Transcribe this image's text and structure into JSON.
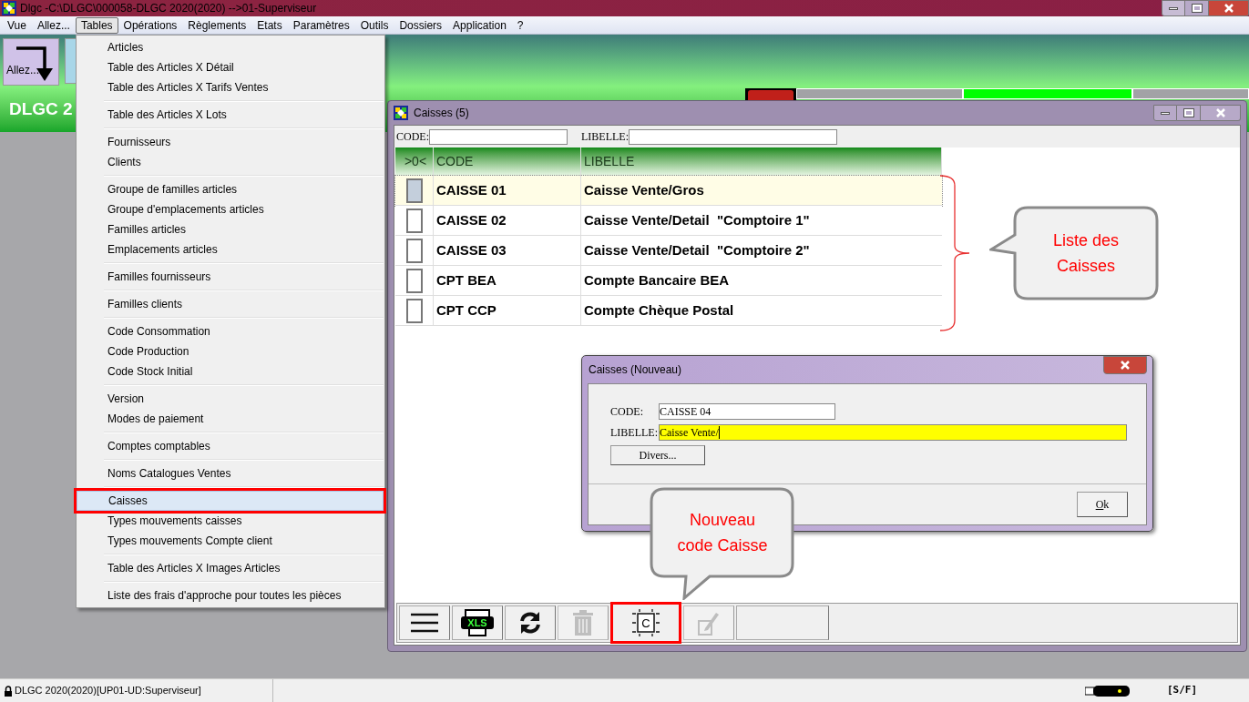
{
  "app": {
    "title": "Dlgc -C:\\DLGC\\000058-DLGC 2020(2020) -->01-Superviseur"
  },
  "menu_bar": [
    {
      "label": "Vue",
      "selected": false
    },
    {
      "label": "Allez...",
      "selected": false
    },
    {
      "label": "Tables",
      "selected": true
    },
    {
      "label": "Opérations",
      "selected": false
    },
    {
      "label": "Règlements",
      "selected": false
    },
    {
      "label": "Etats",
      "selected": false
    },
    {
      "label": "Paramètres",
      "selected": false
    },
    {
      "label": "Outils",
      "selected": false
    },
    {
      "label": "Dossiers",
      "selected": false
    },
    {
      "label": "Application",
      "selected": false
    },
    {
      "label": "?",
      "selected": false
    }
  ],
  "toolbar": {
    "go_button": "Allez...",
    "banner": "DLGC 2"
  },
  "tables_menu": {
    "groups": [
      [
        {
          "label": "Articles",
          "selected": false,
          "annotated": false
        },
        {
          "label": "Table des Articles X Détail",
          "selected": false,
          "annotated": false
        },
        {
          "label": "Table des Articles X Tarifs Ventes",
          "selected": false,
          "annotated": false
        }
      ],
      [
        {
          "label": "Table des Articles X Lots",
          "selected": false,
          "annotated": false
        }
      ],
      [
        {
          "label": "Fournisseurs",
          "selected": false,
          "annotated": false
        },
        {
          "label": "Clients",
          "selected": false,
          "annotated": false
        }
      ],
      [
        {
          "label": "Groupe de familles articles",
          "selected": false,
          "annotated": false
        },
        {
          "label": "Groupe d'emplacements articles",
          "selected": false,
          "annotated": false
        },
        {
          "label": "Familles articles",
          "selected": false,
          "annotated": false
        },
        {
          "label": "Emplacements articles",
          "selected": false,
          "annotated": false
        }
      ],
      [
        {
          "label": "Familles fournisseurs",
          "selected": false,
          "annotated": false
        }
      ],
      [
        {
          "label": "Familles clients",
          "selected": false,
          "annotated": false
        }
      ],
      [
        {
          "label": "Code Consommation",
          "selected": false,
          "annotated": false
        },
        {
          "label": "Code Production",
          "selected": false,
          "annotated": false
        },
        {
          "label": "Code Stock Initial",
          "selected": false,
          "annotated": false
        }
      ],
      [
        {
          "label": "Version",
          "selected": false,
          "annotated": false
        },
        {
          "label": "Modes de paiement",
          "selected": false,
          "annotated": false
        }
      ],
      [
        {
          "label": "Comptes comptables",
          "selected": false,
          "annotated": false
        }
      ],
      [
        {
          "label": "Noms Catalogues Ventes",
          "selected": false,
          "annotated": false
        }
      ],
      [
        {
          "label": "Caisses",
          "selected": true,
          "annotated": true
        },
        {
          "label": "Types mouvements caisses",
          "selected": false,
          "annotated": false
        },
        {
          "label": "Types mouvements Compte client",
          "selected": false,
          "annotated": false
        }
      ],
      [
        {
          "label": "Table des Articles X Images Articles",
          "selected": false,
          "annotated": false
        }
      ],
      [
        {
          "label": "Liste des frais d'approche pour toutes les pièces",
          "selected": false,
          "annotated": false
        }
      ]
    ]
  },
  "caisses_window": {
    "title": "Caisses (5)",
    "filters": [
      {
        "label": "CODE:"
      },
      {
        "label": "LIBELLE:"
      }
    ],
    "columns": [
      ">0<",
      "CODE",
      "LIBELLE"
    ],
    "rows": [
      {
        "code": "CAISSE 01",
        "libelle": "Caisse Vente/Gros",
        "selected": true
      },
      {
        "code": "CAISSE 02",
        "libelle": "Caisse Vente/Detail  \"Comptoire 1\"",
        "selected": false
      },
      {
        "code": "CAISSE 03",
        "libelle": "Caisse Vente/Detail  \"Comptoire 2\"",
        "selected": false
      },
      {
        "code": "CPT BEA",
        "libelle": "Compte Bancaire BEA",
        "selected": false
      },
      {
        "code": "CPT CCP",
        "libelle": "Compte Chèque Postal",
        "selected": false
      }
    ],
    "buttons": [
      {
        "kind": "menu",
        "disabled": false,
        "annotated": false
      },
      {
        "kind": "print",
        "label": "XLS",
        "disabled": false,
        "annotated": false
      },
      {
        "kind": "refresh",
        "disabled": false,
        "annotated": false
      },
      {
        "kind": "delete",
        "disabled": true,
        "annotated": false
      },
      {
        "kind": "new",
        "label": "C",
        "disabled": false,
        "annotated": true
      },
      {
        "kind": "edit",
        "disabled": true,
        "annotated": false
      },
      {
        "kind": "blank",
        "disabled": false,
        "annotated": false
      }
    ]
  },
  "dialog": {
    "title": "Caisses  (Nouveau)",
    "fields": [
      {
        "label": "CODE:",
        "value": "CAISSE 04",
        "focused": false
      },
      {
        "label": "LIBELLE:",
        "value": "Caisse Vente/",
        "focused": true
      }
    ],
    "divers_button": "Divers...",
    "ok_button": "Ok"
  },
  "list_callout": {
    "text": "Liste des Caisses"
  },
  "new_code_callout": {
    "text": "Nouveau code Caisse"
  },
  "status_bar": {
    "session": "DLGC 2020(2020)[UP01-UD:Superviseur]",
    "mode": "[S/F]"
  }
}
